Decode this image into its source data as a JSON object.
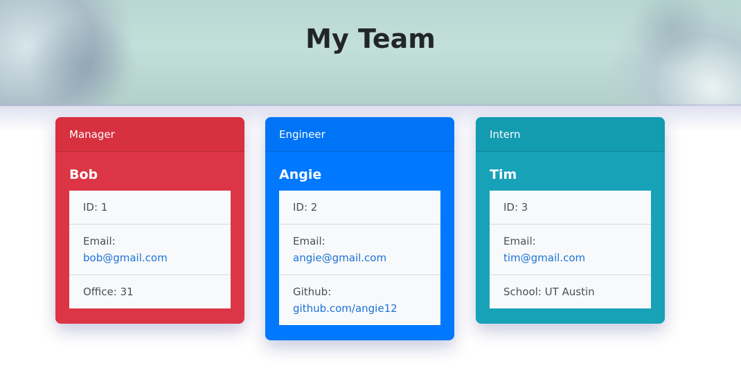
{
  "header": {
    "title": "My Team"
  },
  "colors": {
    "manager": "#dc3545",
    "engineer": "#007bff",
    "intern": "#17a2b8",
    "link": "#1a73d9"
  },
  "cards": [
    {
      "role": "Manager",
      "name": "Bob",
      "id_text": "ID: 1",
      "email_label": "Email:",
      "email": "bob@gmail.com",
      "extra_label": "Office: 31",
      "extra_link": ""
    },
    {
      "role": "Engineer",
      "name": "Angie",
      "id_text": "ID: 2",
      "email_label": "Email:",
      "email": "angie@gmail.com",
      "extra_label": "Github:",
      "extra_link": "github.com/angie12"
    },
    {
      "role": "Intern",
      "name": "Tim",
      "id_text": "ID: 3",
      "email_label": "Email:",
      "email": "tim@gmail.com",
      "extra_label": "School: UT Austin",
      "extra_link": ""
    }
  ]
}
